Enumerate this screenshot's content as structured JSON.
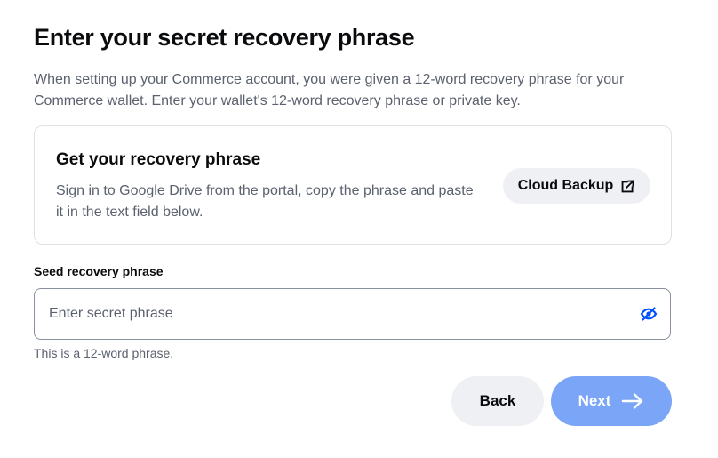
{
  "header": {
    "title": "Enter your secret recovery phrase",
    "intro": "When setting up your Commerce account, you were given a 12-word recovery phrase for your Commerce wallet. Enter your wallet's 12-word recovery phrase or private key."
  },
  "card": {
    "title": "Get your recovery phrase",
    "text": "Sign in to Google Drive from the portal, copy the phrase and paste it in the text field below.",
    "button_label": "Cloud Backup",
    "button_icon": "external-link-icon"
  },
  "field": {
    "label": "Seed recovery phrase",
    "value": "",
    "placeholder": "Enter secret phrase",
    "visibility_icon": "eye-off-icon",
    "helper": "This is a 12-word phrase."
  },
  "actions": {
    "back_label": "Back",
    "next_label": "Next",
    "next_icon": "arrow-right-icon",
    "next_disabled": true
  },
  "colors": {
    "accent": "#0052ff",
    "next_disabled_bg": "#7ba5f6",
    "secondary_bg": "#eef0f3",
    "muted_text": "#5b616e"
  }
}
